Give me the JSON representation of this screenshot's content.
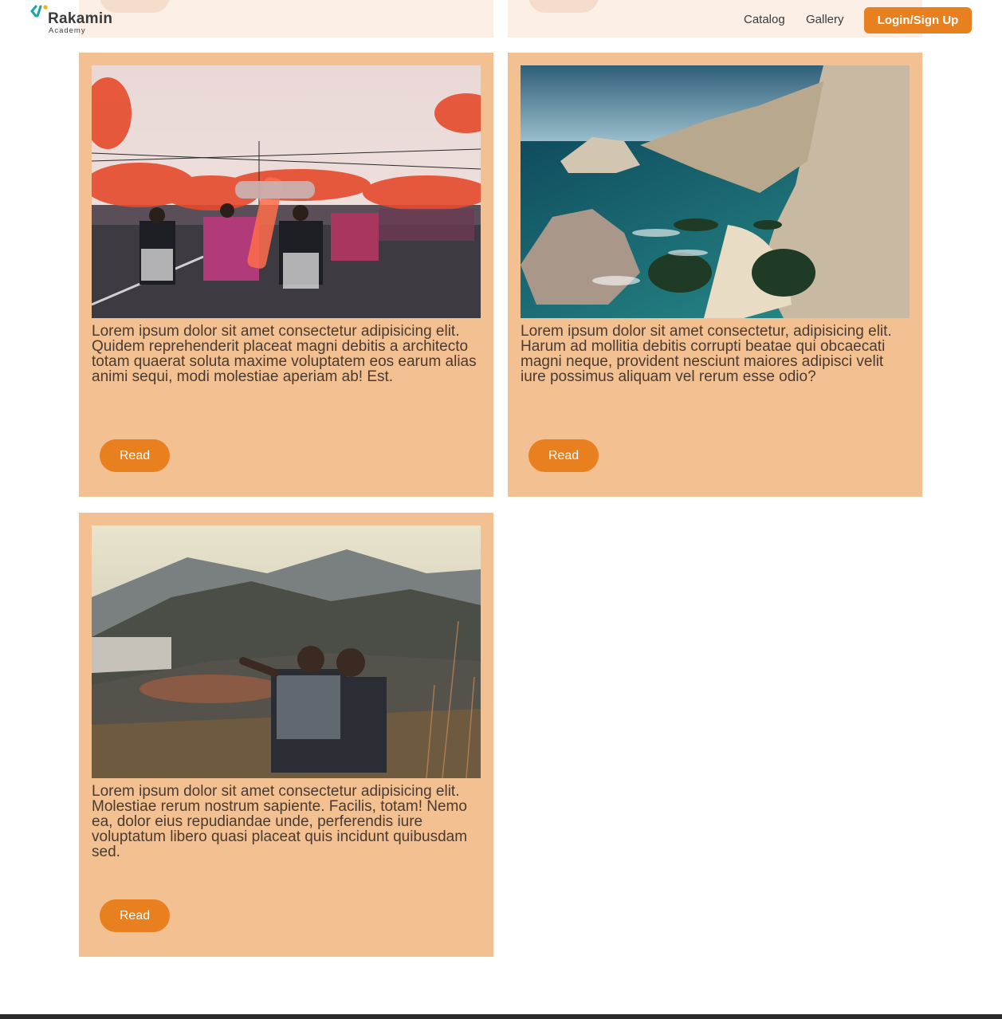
{
  "brand": {
    "name": "Rakamin",
    "tagline": "Academy"
  },
  "nav": {
    "catalog": "Catalog",
    "gallery": "Gallery",
    "login": "Login/Sign Up"
  },
  "colors": {
    "accent": "#e8801f",
    "card_bg": "#f3c091",
    "logo_teal": "#1aa6a6",
    "logo_yellow": "#f2b705"
  },
  "cards": [
    {
      "image": "street-parade-photo",
      "text": "Lorem ipsum dolor sit amet consectetur adipisicing elit. Quidem reprehenderit placeat magni debitis a architecto totam quaerat soluta maxime voluptatem eos earum alias animi sequi, modi molestiae aperiam ab! Est.",
      "button": "Read"
    },
    {
      "image": "coastal-cliff-beach-photo",
      "text": "Lorem ipsum dolor sit amet consectetur, adipisicing elit. Harum ad mollitia debitis corrupti beatae qui obcaecati magni neque, provident nesciunt maiores adipisci velit iure possimus aliquam vel rerum esse odio?",
      "button": "Read"
    },
    {
      "image": "mountain-valley-kids-photo",
      "text": "Lorem ipsum dolor sit amet consectetur adipisicing elit. Molestiae rerum nostrum sapiente. Facilis, totam! Nemo ea, dolor eius repudiandae unde, perferendis iure voluptatum libero quasi placeat quis incidunt quibusdam sed.",
      "button": "Read"
    }
  ]
}
